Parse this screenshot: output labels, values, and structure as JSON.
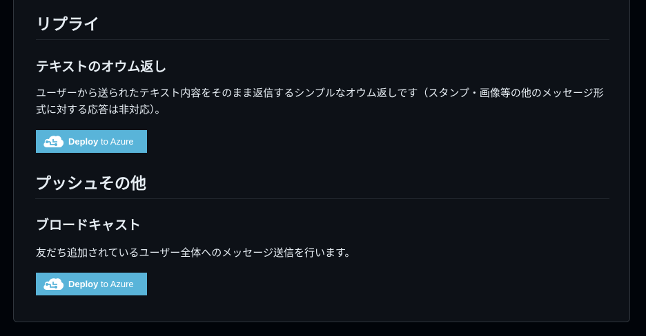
{
  "sections": [
    {
      "heading": "リプライ",
      "subheading": "テキストのオウム返し",
      "description": "ユーザーから送られたテキスト内容をそのまま返信するシンプルなオウム返しです（スタンプ・画像等の他のメッセージ形式に対する応答は非対応）。",
      "deploy": {
        "bold": "Deploy",
        "rest": " to Azure"
      }
    },
    {
      "heading": "プッシュその他",
      "subheading": "ブロードキャスト",
      "description": "友だち追加されているユーザー全体へのメッセージ送信を行います。",
      "deploy": {
        "bold": "Deploy",
        "rest": " to Azure"
      }
    }
  ],
  "colors": {
    "page_bg": "#010409",
    "panel_bg": "#0d1117",
    "border": "#30363d",
    "text": "#e6edf3",
    "deploy_bg": "#59b4d9"
  },
  "icons": {
    "deploy": "azure-cloud-icon"
  }
}
